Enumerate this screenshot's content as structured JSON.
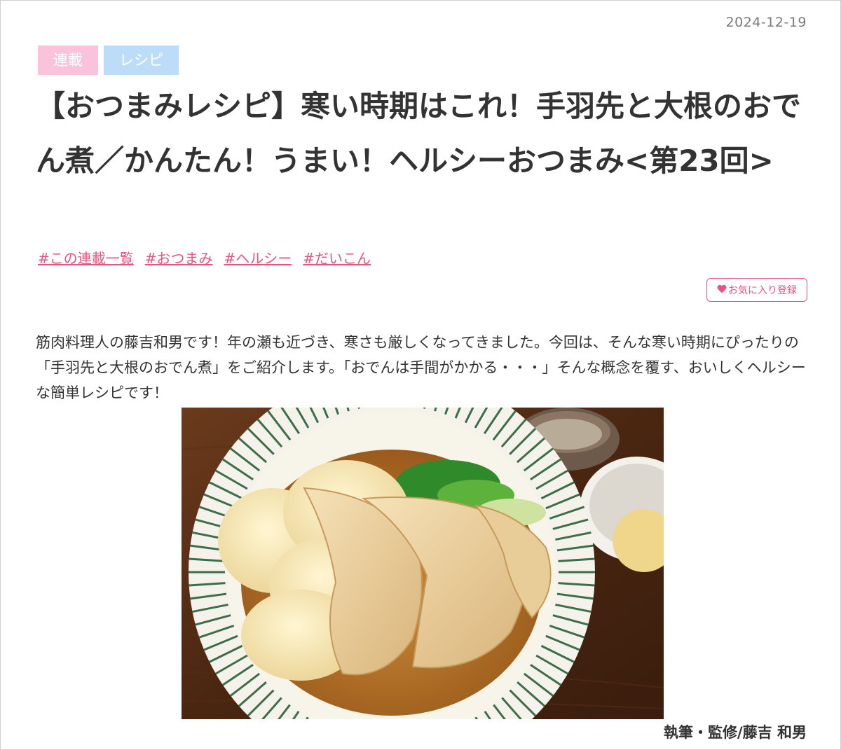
{
  "article": {
    "date": "2024-12-19",
    "categories": [
      "連載",
      "レシピ"
    ],
    "title": "【おつまみレシピ】寒い時期はこれ！手羽先と大根のおでん煮／かんたん！うまい！ヘルシーおつまみ<第23回>",
    "tags": [
      "#この連載一覧",
      "#おつまみ",
      "#ヘルシー",
      "#だいこん"
    ],
    "favorite_label": "お気に入り登録",
    "lead": "筋肉料理人の藤吉和男です！年の瀬も近づき、寒さも厳しくなってきました。今回は、そんな寒い時期にぴったりの「手羽先と大根のおでん煮」をご紹介します。「おでんは手間がかかる・・・」そんな概念を覆す、おいしくヘルシーな簡単レシピです！",
    "credit": "執筆・監修/藤吉 和男"
  },
  "colors": {
    "accent_pink": "#e4567d",
    "category_serial": "#f9c3dc",
    "category_recipe": "#bcdcf8"
  },
  "icons": {
    "favorite": "heart-icon"
  }
}
